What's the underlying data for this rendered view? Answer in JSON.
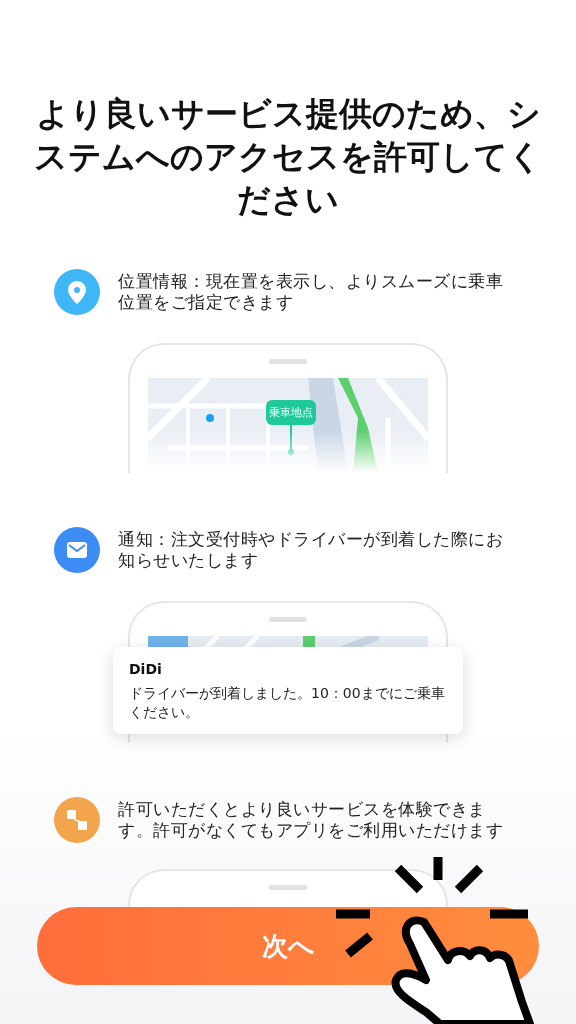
{
  "title": "より良いサービス提供のため、システムへのアクセスを許可してください",
  "permissions": [
    {
      "kind": "location",
      "text": "位置情報：現在置を表示し、よりスムーズに乗車位置をご指定できます",
      "preview": {
        "kind": "map",
        "pin_label": "乗車地点"
      }
    },
    {
      "kind": "mail",
      "text": "通知：注文受付時やドライバーが到着した際にお知らせいたします",
      "preview": {
        "kind": "notification",
        "app": "DiDi",
        "message": "ドライバーが到着しました。10：00までにご乗車ください。"
      }
    },
    {
      "kind": "flow",
      "text": "許可いただくとより良いサービスを体験できます。許可がなくてもアプリをご利用いただけます",
      "preview": {
        "kind": "blank"
      }
    }
  ],
  "next_button": "次へ"
}
